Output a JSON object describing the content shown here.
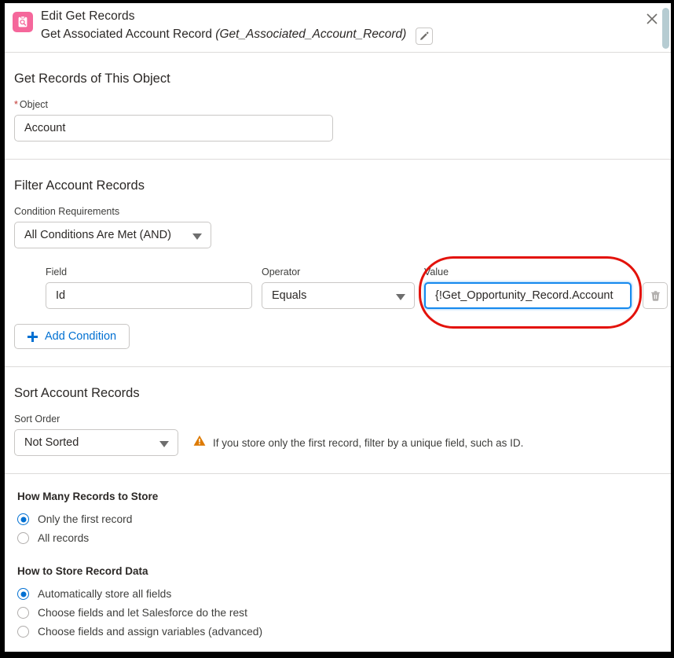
{
  "header": {
    "icon": "get-records-icon",
    "title": "Edit Get Records",
    "label": "Get Associated Account Record",
    "api_name": "(Get_Associated_Account_Record)",
    "edit_icon": "pencil-icon",
    "close_icon": "close-icon"
  },
  "object_section": {
    "title": "Get Records of This Object",
    "object_label": "Object",
    "required_marker": "*",
    "object_value": "Account"
  },
  "filter_section": {
    "title": "Filter Account Records",
    "condition_requirements_label": "Condition Requirements",
    "condition_requirements_value": "All Conditions Are Met (AND)",
    "condition": {
      "field_label": "Field",
      "field_value": "Id",
      "operator_label": "Operator",
      "operator_value": "Equals",
      "value_label": "Value",
      "value_value": "{!Get_Opportunity_Record.Account",
      "delete_icon": "trash-icon"
    },
    "add_condition_label": "Add Condition",
    "add_condition_icon": "plus-icon"
  },
  "sort_section": {
    "title": "Sort Account Records",
    "sort_order_label": "Sort Order",
    "sort_order_value": "Not Sorted",
    "warning_icon": "warning-triangle-icon",
    "warning_text": "If you store only the first record, filter by a unique field, such as ID."
  },
  "store_section": {
    "how_many_title": "How Many Records to Store",
    "how_many_options": [
      {
        "label": "Only the first record",
        "selected": true
      },
      {
        "label": "All records",
        "selected": false
      }
    ],
    "how_to_store_title": "How to Store Record Data",
    "how_to_store_options": [
      {
        "label": "Automatically store all fields",
        "selected": true
      },
      {
        "label": "Choose fields and let Salesforce do the rest",
        "selected": false
      },
      {
        "label": "Choose fields and assign variables (advanced)",
        "selected": false
      }
    ]
  },
  "annotation": {
    "shape": "red-oval-highlight",
    "color": "#e3120b",
    "targets": "value-field"
  },
  "colors": {
    "accent": "#0070d2",
    "icon_pink": "#f5679b",
    "warning": "#dd7a01",
    "required": "#c23934",
    "focus_border": "#1589ee"
  },
  "scrollbar": {
    "name": "vertical-scrollbar"
  }
}
